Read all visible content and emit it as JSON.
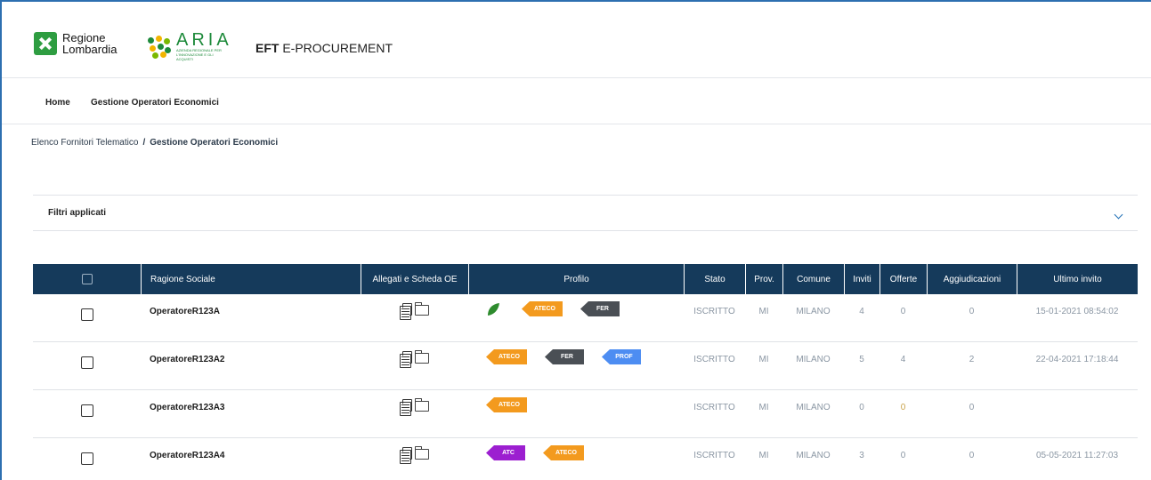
{
  "header": {
    "regione_line1": "Regione",
    "regione_line2": "Lombardia",
    "aria_name": "ARIA",
    "aria_subtitle": "AZIENDA REGIONALE PER L'INNOVAZIONE E GLI ACQUISTI",
    "app_title_bold": "EFT",
    "app_title_rest": " E-PROCUREMENT"
  },
  "nav": {
    "home": "Home",
    "gestione": "Gestione Operatori Economici"
  },
  "breadcrumb": {
    "parent": "Elenco Fornitori Telematico",
    "separator": "/",
    "current": "Gestione Operatori Economici"
  },
  "filters": {
    "label": "Filtri applicati"
  },
  "table": {
    "headers": {
      "ragione_sociale": "Ragione Sociale",
      "allegati": "Allegati e Scheda OE",
      "profilo": "Profilo",
      "stato": "Stato",
      "prov": "Prov.",
      "comune": "Comune",
      "inviti": "Inviti",
      "offerte": "Offerte",
      "aggiudicazioni": "Aggiudicazioni",
      "ultimo_invito": "Ultimo invito"
    },
    "rows": [
      {
        "name": "OperatoreR123A",
        "stato": "ISCRITTO",
        "prov": "MI",
        "comune": "MILANO",
        "inviti": "4",
        "offerte": "0",
        "aggiudicazioni": "0",
        "ultimo_invito": "15-01-2021 08:54:02",
        "badges": [
          "leaf",
          "ATECO",
          "FER"
        ]
      },
      {
        "name": "OperatoreR123A2",
        "stato": "ISCRITTO",
        "prov": "MI",
        "comune": "MILANO",
        "inviti": "5",
        "offerte": "4",
        "aggiudicazioni": "2",
        "ultimo_invito": "22-04-2021 17:18:44",
        "badges": [
          "ATECO",
          "FER",
          "PROF"
        ]
      },
      {
        "name": "OperatoreR123A3",
        "stato": "ISCRITTO",
        "prov": "MI",
        "comune": "MILANO",
        "inviti": "0",
        "offerte": "0",
        "aggiudicazioni": "0",
        "ultimo_invito": "",
        "badges": [
          "ATECO"
        ]
      },
      {
        "name": "OperatoreR123A4",
        "stato": "ISCRITTO",
        "prov": "MI",
        "comune": "MILANO",
        "inviti": "3",
        "offerte": "0",
        "aggiudicazioni": "0",
        "ultimo_invito": "05-05-2021 11:27:03",
        "badges": [
          "ATC",
          "ATECO"
        ]
      }
    ]
  },
  "colors": {
    "header_bg": "#153a5b",
    "ateco": "#f39a1e",
    "fer": "#4a4f55",
    "prof": "#4d8df2",
    "atc": "#9c1fd0",
    "leaf": "#2e8b2e"
  }
}
